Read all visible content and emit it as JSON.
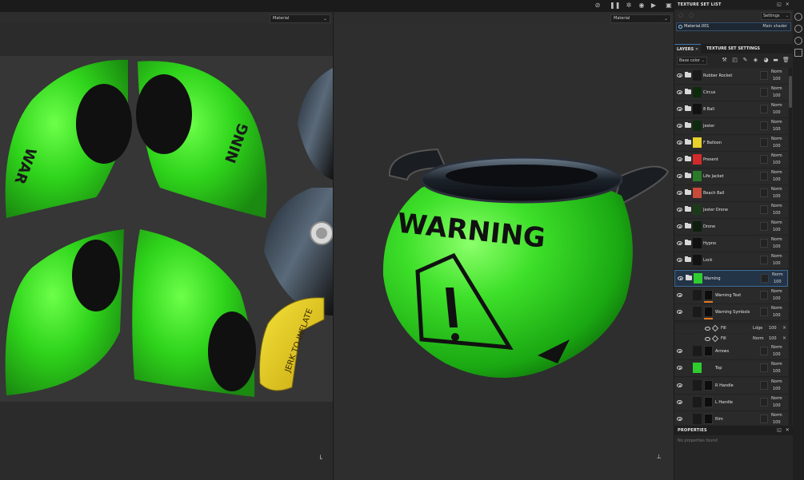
{
  "toolbar": {
    "icons": [
      "camera-off-icon",
      "pause-icon",
      "light-icon",
      "environment-icon",
      "video-icon",
      "screenshot-icon"
    ]
  },
  "viewport_2d": {
    "dropdown": "Material"
  },
  "viewport_3d": {
    "dropdown": "Material",
    "model_text": "WARNING"
  },
  "uv_texture_texts": {
    "left_top": "WAR",
    "right_top": "NING",
    "yellow": "JERK TO INFLATE"
  },
  "texture_set_list": {
    "title": "TEXTURE SET LIST",
    "settings_label": "Settings",
    "material_name": "Material.001",
    "shader_name": "Main shader"
  },
  "layers_panel": {
    "tab_layers": "LAYERS",
    "tab_tss": "TEXTURE SET SETTINGS",
    "channel": "Base color",
    "layers": [
      {
        "name": "Rubber Rocket",
        "blend": "Norm",
        "opacity": "100",
        "type": "folder",
        "thumb_color": "#1a1a1a"
      },
      {
        "name": "Circus",
        "blend": "Norm",
        "opacity": "100",
        "type": "folder",
        "thumb_color": "#0d2a0d"
      },
      {
        "name": "8 Ball",
        "blend": "Norm",
        "opacity": "100",
        "type": "folder",
        "thumb_color": "#111111"
      },
      {
        "name": "Jester",
        "blend": "Norm",
        "opacity": "100",
        "type": "folder",
        "thumb_color": "#0f2a10"
      },
      {
        "name": "F Balloon",
        "blend": "Norm",
        "opacity": "100",
        "type": "folder",
        "thumb_color": "#e8d12a"
      },
      {
        "name": "Present",
        "blend": "Norm",
        "opacity": "100",
        "type": "folder",
        "thumb_color": "#d22a2a"
      },
      {
        "name": "Life Jacket",
        "blend": "Norm",
        "opacity": "100",
        "type": "folder",
        "thumb_color": "#2a7a2a"
      },
      {
        "name": "Beach Ball",
        "blend": "Norm",
        "opacity": "100",
        "type": "folder",
        "thumb_color": "#c84a3a"
      },
      {
        "name": "Jester Drone",
        "blend": "Norm",
        "opacity": "100",
        "type": "folder",
        "thumb_color": "#1a3a1a"
      },
      {
        "name": "Drone",
        "blend": "Norm",
        "opacity": "100",
        "type": "folder",
        "thumb_color": "#0f1f0f"
      },
      {
        "name": "Hypno",
        "blend": "Norm",
        "opacity": "100",
        "type": "folder",
        "thumb_color": "#101010"
      },
      {
        "name": "Lock",
        "blend": "Norm",
        "opacity": "100",
        "type": "folder",
        "thumb_color": "#121212"
      },
      {
        "name": "Warning",
        "blend": "Norm",
        "opacity": "100",
        "type": "folder-open",
        "thumb_color": "#2ecc2e",
        "selected": true
      },
      {
        "name": "Warning Text",
        "blend": "Norm",
        "opacity": "100",
        "type": "fill",
        "thumb_color": "#1a1a1a"
      },
      {
        "name": "Warning Symbols",
        "blend": "Norm",
        "opacity": "100",
        "type": "fill",
        "thumb_color": "#1a1a1a"
      },
      {
        "name": "Arrows",
        "blend": "Norm",
        "opacity": "100",
        "type": "fill",
        "thumb_color": "#1a1a1a"
      },
      {
        "name": "Top",
        "blend": "Norm",
        "opacity": "100",
        "type": "fill",
        "thumb_color": "#2ecc2e"
      },
      {
        "name": "R Handle",
        "blend": "Norm",
        "opacity": "100",
        "type": "fill",
        "thumb_color": "#1a1a1a"
      },
      {
        "name": "L Handle",
        "blend": "Norm",
        "opacity": "100",
        "type": "fill",
        "thumb_color": "#1a1a1a"
      },
      {
        "name": "Rim",
        "blend": "Norm",
        "opacity": "100",
        "type": "fill",
        "thumb_color": "#1a1a1a"
      }
    ],
    "effects": [
      {
        "name": "Fill",
        "blend": "Ldge",
        "opacity": "100"
      },
      {
        "name": "Fill",
        "blend": "Norm",
        "opacity": "100"
      }
    ]
  },
  "properties": {
    "title": "PROPERTIES",
    "empty_text": "No properties found"
  }
}
